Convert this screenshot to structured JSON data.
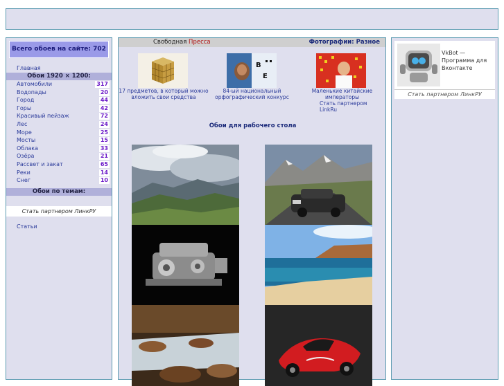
{
  "left": {
    "total_label": "Всего обоев на сайте: 702",
    "home": "Главная",
    "resolution_header": "Обои 1920 × 1200:",
    "categories": [
      {
        "name": "Автомобили",
        "count": "317"
      },
      {
        "name": "Водопады",
        "count": "20"
      },
      {
        "name": "Город",
        "count": "44"
      },
      {
        "name": "Горы",
        "count": "42"
      },
      {
        "name": "Красивый пейзаж",
        "count": "72"
      },
      {
        "name": "Лес",
        "count": "24"
      },
      {
        "name": "Море",
        "count": "25"
      },
      {
        "name": "Мосты",
        "count": "15"
      },
      {
        "name": "Облака",
        "count": "33"
      },
      {
        "name": "Озёра",
        "count": "21"
      },
      {
        "name": "Рассвет и закат",
        "count": "65"
      },
      {
        "name": "Реки",
        "count": "14"
      },
      {
        "name": "Снег",
        "count": "10"
      }
    ],
    "themes_header": "Обои по темам:",
    "partner": "Стать партнером ЛинкРУ",
    "articles": "Статьи"
  },
  "center": {
    "press_prefix": "Свободная ",
    "press_word": "Пресса",
    "photos": "Фотографии: Разное",
    "news": [
      {
        "caption_line1": "17 предметов, в который можно",
        "caption_line2": "вложить свои средства"
      },
      {
        "caption_line1": "84-ый национальный",
        "caption_line2": "орфографический конкурс"
      },
      {
        "caption_line1": "Маленькие китайские",
        "caption_line2": "императоры"
      }
    ],
    "partner": "Стать партнером LinkRu",
    "wallpapers_title": "Обои для рабочего стола"
  },
  "right": {
    "vkbot_line1": "VkBot —",
    "vkbot_line2": "Программа для",
    "vkbot_line3": "Вконтакте",
    "partner": "Стать партнером ЛинкРУ"
  }
}
